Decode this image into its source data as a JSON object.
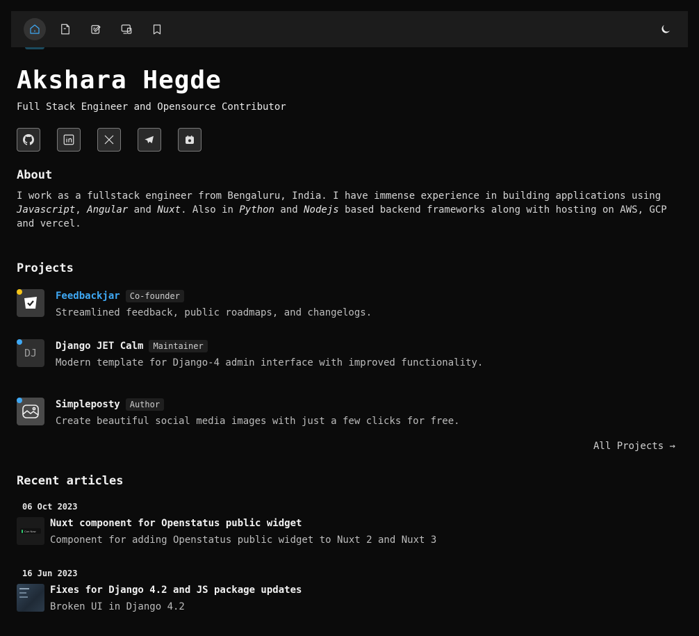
{
  "nav": {
    "items": [
      {
        "icon": "home-icon",
        "active": true
      },
      {
        "icon": "document-icon",
        "active": false
      },
      {
        "icon": "edit-icon",
        "active": false
      },
      {
        "icon": "devices-icon",
        "active": false
      },
      {
        "icon": "bookmark-icon",
        "active": false
      }
    ],
    "theme_icon": "moon-icon"
  },
  "profile": {
    "name": "Akshara Hegde",
    "tagline": "Full Stack Engineer and Opensource Contributor",
    "socials": [
      "github-icon",
      "linkedin-icon",
      "x-icon",
      "telegram-icon",
      "calendar-icon"
    ]
  },
  "about": {
    "title": "About",
    "text_1": "I work as a fullstack engineer from Bengaluru, India. I have immense experience in building applications using",
    "em_1": "Javascript",
    "sep_1": ",",
    "em_2": "Angular",
    "sep_2": "and",
    "em_3": "Nuxt",
    "sep_3": ". Also in",
    "em_4": "Python",
    "sep_4": "and",
    "em_5": "Nodejs",
    "text_2": "based backend frameworks along with hosting on AWS, GCP and vercel."
  },
  "projects": {
    "title": "Projects",
    "items": [
      {
        "name": "Feedbackjar",
        "role": "Co-founder",
        "desc": "Streamlined feedback, public roadmaps, and changelogs.",
        "dot_color": "#f5c518"
      },
      {
        "name": "Django JET Calm",
        "role": "Maintainer",
        "desc": "Modern template for Django-4 admin interface with improved functionality.",
        "dot_color": "#3fa9f5",
        "icon_text": "DJ"
      },
      {
        "name": "Simpleposty",
        "role": "Author",
        "desc": "Create beautiful social media images with just a few clicks for free.",
        "dot_color": "#3fa9f5"
      }
    ],
    "all_link": "All Projects →"
  },
  "articles": {
    "title": "Recent articles",
    "items": [
      {
        "date": "06 Oct 2023",
        "title": "Nuxt component for Openstatus public widget",
        "desc": "Component for adding Openstatus public widget to Nuxt 2 and Nuxt 3",
        "thumb_text": "Con Now"
      },
      {
        "date": "16 Jun 2023",
        "title": "Fixes for Django 4.2 and JS package updates",
        "desc": "Broken UI in Django 4.2"
      }
    ]
  }
}
